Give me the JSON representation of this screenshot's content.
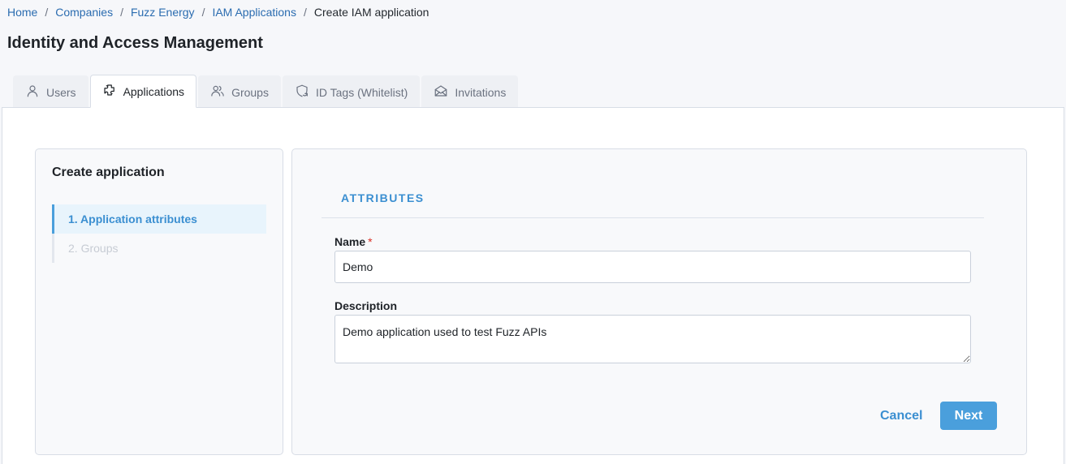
{
  "breadcrumb": {
    "items": [
      "Home",
      "Companies",
      "Fuzz Energy",
      "IAM Applications"
    ],
    "separator": "/",
    "current": "Create IAM application"
  },
  "page": {
    "title": "Identity and Access Management"
  },
  "tabs": [
    {
      "label": "Users",
      "icon": "user-icon",
      "active": false
    },
    {
      "label": "Applications",
      "icon": "puzzle-icon",
      "active": true
    },
    {
      "label": "Groups",
      "icon": "users-icon",
      "active": false
    },
    {
      "label": "ID Tags (Whitelist)",
      "icon": "shield-refresh-icon",
      "active": false
    },
    {
      "label": "Invitations",
      "icon": "mail-open-icon",
      "active": false
    }
  ],
  "wizard": {
    "title": "Create application",
    "steps": [
      {
        "label": "1. Application attributes",
        "active": true
      },
      {
        "label": "2. Groups",
        "active": false
      }
    ]
  },
  "form": {
    "section_title": "ATTRIBUTES",
    "name": {
      "label": "Name",
      "required_marker": "*",
      "value": "Demo"
    },
    "description": {
      "label": "Description",
      "value": "Demo application used to test Fuzz APIs"
    },
    "cancel_label": "Cancel",
    "next_label": "Next"
  },
  "colors": {
    "accent": "#4a9fdc",
    "link": "#2b6cb0",
    "required": "#d93025"
  }
}
